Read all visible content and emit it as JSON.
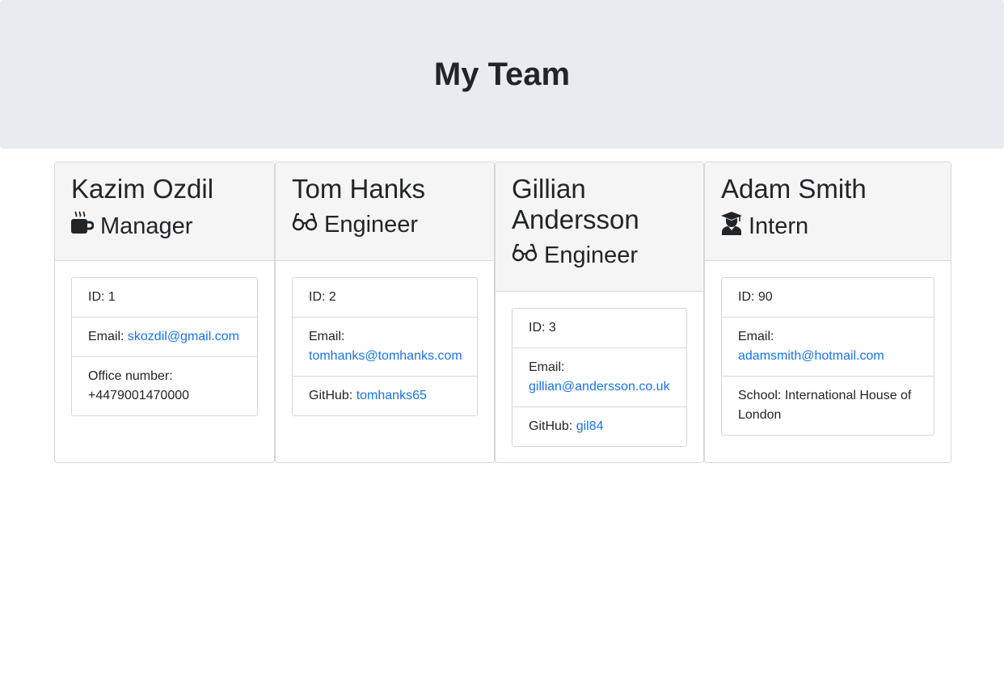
{
  "header": {
    "title": "My Team"
  },
  "employees": [
    {
      "name": "Kazim Ozdil",
      "role": "Manager",
      "role_icon": "coffee-mug-icon",
      "id_text": "ID: 1",
      "email_label": "Email:",
      "email": "skozdil@gmail.com",
      "extra_label": "Office number:",
      "extra_value": "+4479001470000"
    },
    {
      "name": "Tom Hanks",
      "role": "Engineer",
      "role_icon": "glasses-icon",
      "id_text": "ID: 2",
      "email_label": "Email:",
      "email": "tomhanks@tomhanks.com",
      "extra_label": "GitHub:",
      "extra_value": "tomhanks65"
    },
    {
      "name_line1": "Gillian",
      "name_line2": "Andersson",
      "role": "Engineer",
      "role_icon": "glasses-icon",
      "id_text": "ID: 3",
      "email_label": "Email:",
      "email": "gillian@andersson.co.uk",
      "extra_label": "GitHub:",
      "extra_value": "gil84"
    },
    {
      "name": "Adam Smith",
      "role": "Intern",
      "role_icon": "graduate-icon",
      "id_text": "ID: 90",
      "email_label": "Email:",
      "email": "adamsmith@hotmail.com",
      "extra_label": "School:",
      "extra_value": "International House of London"
    }
  ],
  "colors": {
    "jumbotron_bg": "#e9ecef",
    "card_header_bg": "#f5f5f5",
    "link": "#1a73e8",
    "text": "#212529"
  }
}
